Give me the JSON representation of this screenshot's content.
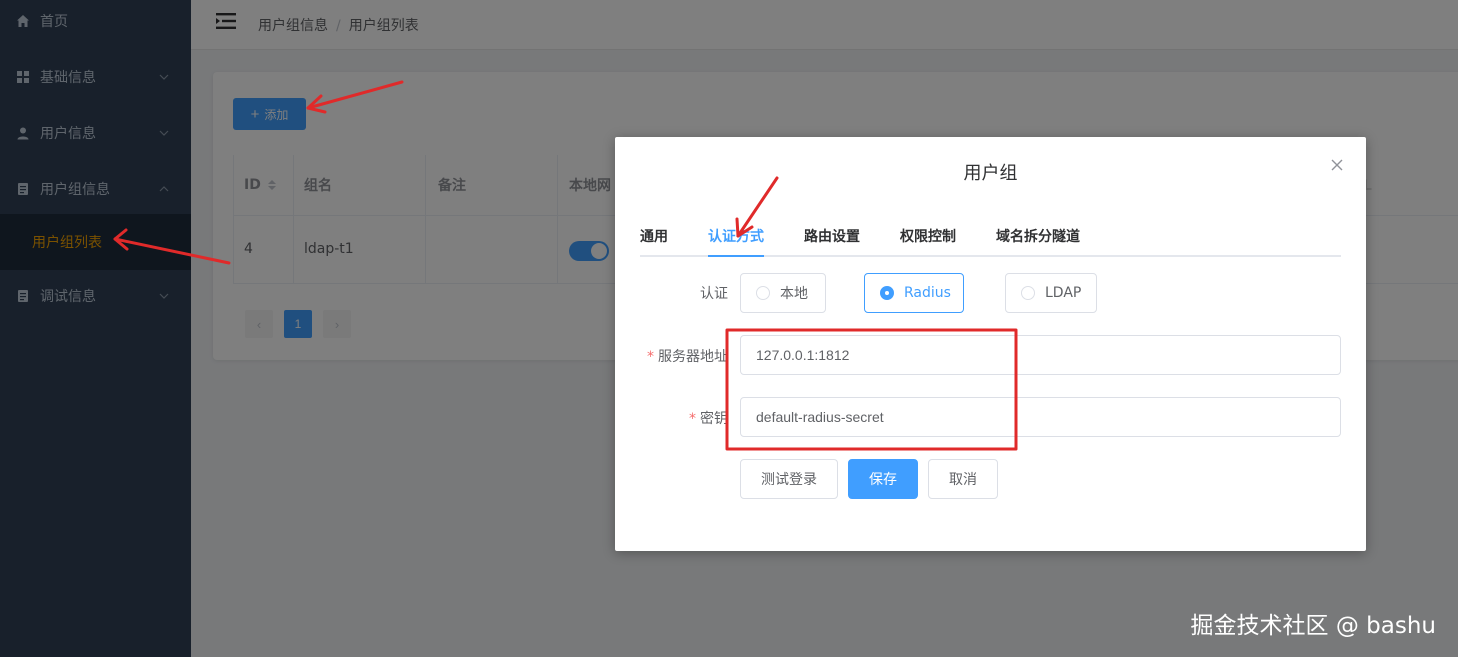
{
  "sidebar": {
    "items": [
      {
        "label": "首页",
        "icon": "home-icon"
      },
      {
        "label": "基础信息",
        "icon": "grid-icon"
      },
      {
        "label": "用户信息",
        "icon": "user-icon"
      },
      {
        "label": "用户组信息",
        "icon": "group-icon"
      },
      {
        "label": "调试信息",
        "icon": "debug-icon"
      }
    ],
    "sub_item": {
      "label": "用户组列表"
    },
    "active_color": "#f4a300"
  },
  "header": {
    "breadcrumb": [
      "用户组信息",
      "用户组列表"
    ]
  },
  "main": {
    "add_label": "添加",
    "table": {
      "columns": [
        "ID",
        "组名",
        "备注",
        "本地网"
      ],
      "partial_column": "L",
      "row": {
        "id": "4",
        "name": "ldap-t1",
        "note": "",
        "local_network_enabled": true
      }
    },
    "pagination": {
      "prev": "‹",
      "current": "1",
      "next": "›"
    }
  },
  "dialog": {
    "title": "用户组",
    "tabs": [
      "通用",
      "认证方式",
      "路由设置",
      "权限控制",
      "域名拆分隧道"
    ],
    "active_tab": 1,
    "auth": {
      "label": "认证",
      "options": [
        "本地",
        "Radius",
        "LDAP"
      ],
      "selected": "Radius"
    },
    "server": {
      "label": "服务器地址",
      "value": "127.0.0.1:1812"
    },
    "secret": {
      "label": "密钥",
      "value": "default-radius-secret"
    },
    "buttons": {
      "test": "测试登录",
      "save": "保存",
      "cancel": "取消"
    }
  },
  "watermark": "掘金技术社区 @ bashu",
  "colors": {
    "primary": "#409eff",
    "sidebar_bg": "#304156",
    "annotation_red": "#e02a2a"
  }
}
